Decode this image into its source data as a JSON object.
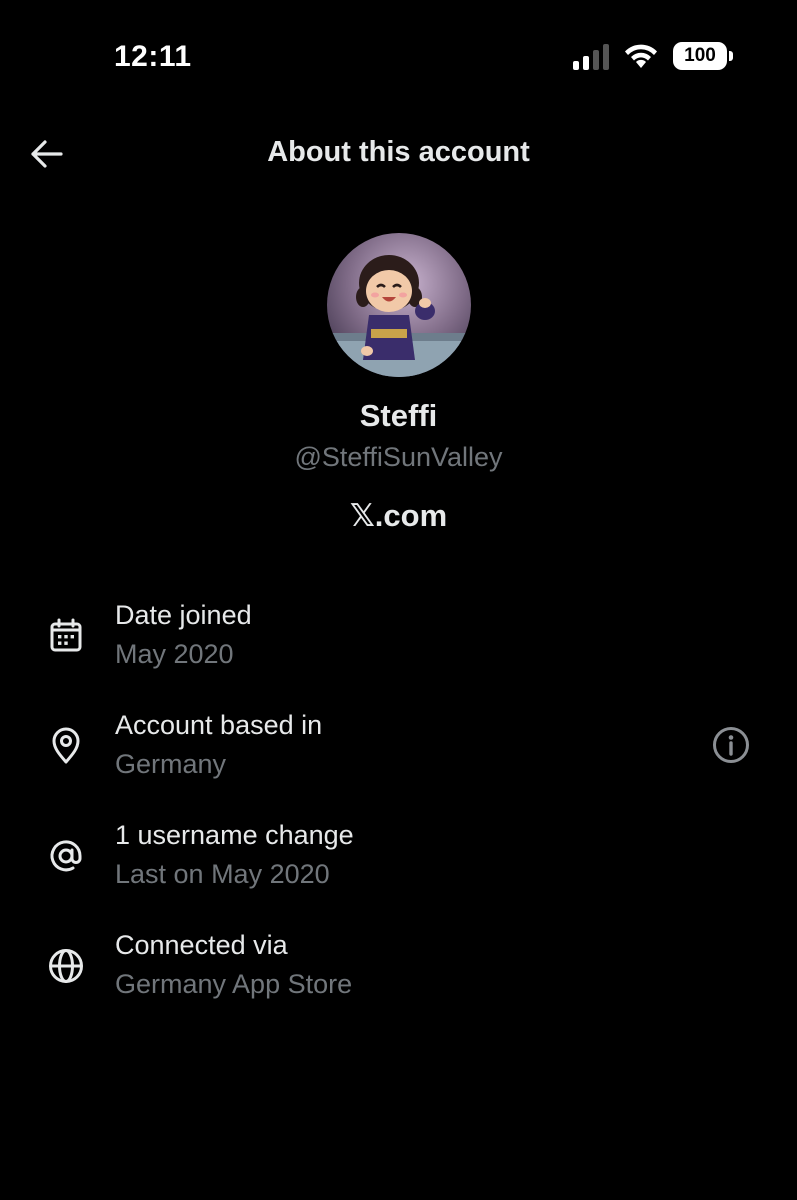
{
  "status_bar": {
    "time": "12:11",
    "battery": "100",
    "icons": [
      "signal-icon",
      "wifi-icon",
      "battery-icon"
    ]
  },
  "header": {
    "title": "About this account",
    "back_icon": "arrow-left-icon"
  },
  "profile": {
    "display_name": "Steffi",
    "handle": "@SteffiSunValley",
    "platform": "𝕏.com"
  },
  "info_rows": [
    {
      "icon": "calendar-icon",
      "title": "Date joined",
      "value": "May 2020"
    },
    {
      "icon": "location-pin-icon",
      "title": "Account based in",
      "value": "Germany",
      "action_icon": "info-icon"
    },
    {
      "icon": "at-sign-icon",
      "title": "1 username change",
      "value": "Last on May 2020"
    },
    {
      "icon": "globe-icon",
      "title": "Connected via",
      "value": "Germany App Store"
    }
  ],
  "colors": {
    "background": "#000000",
    "primary_text": "#e7e9ea",
    "secondary_text": "#71767b"
  }
}
